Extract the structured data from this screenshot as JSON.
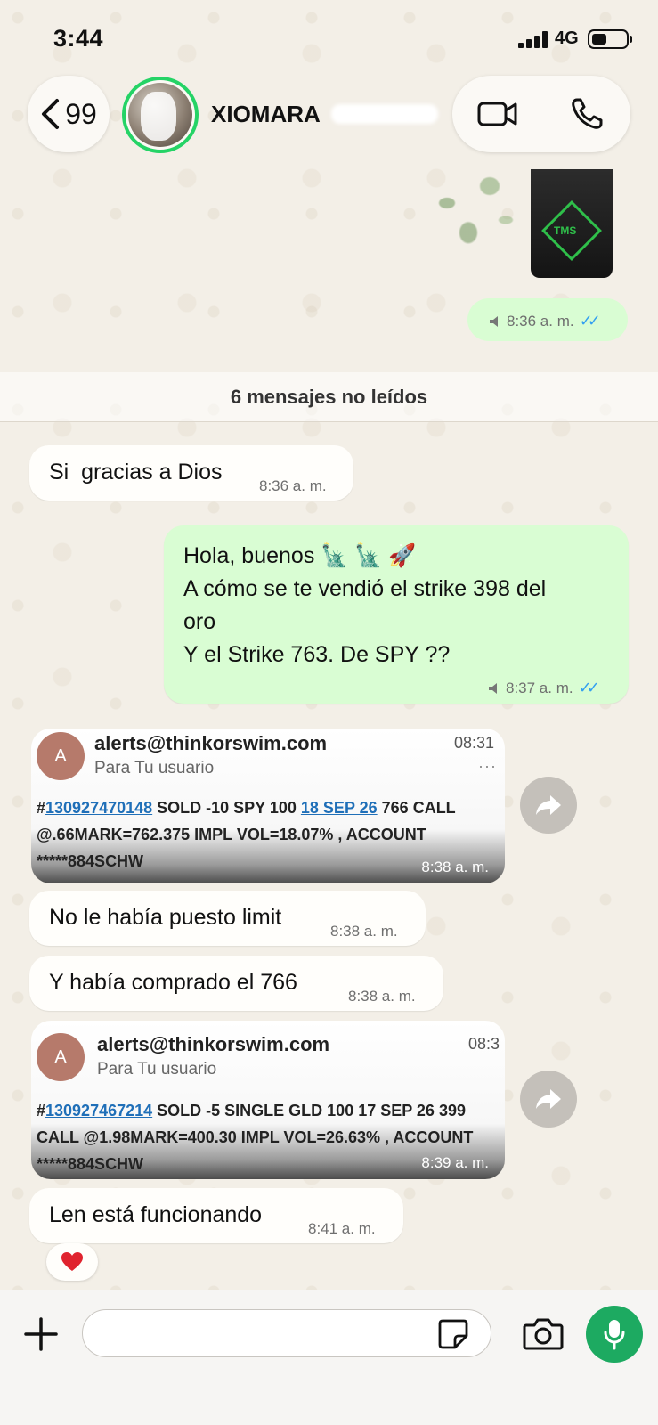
{
  "status_bar": {
    "time": "3:44",
    "network": "4G"
  },
  "header": {
    "back_count": "99",
    "contact_name": "XIOMARA"
  },
  "media_message": {
    "time": "8:36 a. m."
  },
  "unread_divider": "6 mensajes no leídos",
  "messages": [
    {
      "direction": "in",
      "text": "Si  gracias a Dios",
      "time": "8:36 a. m."
    },
    {
      "direction": "out",
      "text": "Hola, buenos 🗽 🗽 🚀\nA cómo se te vendió el strike 398 del\noro\nY el Strike 763. De SPY ??",
      "time": "8:37 a. m."
    },
    {
      "direction": "in",
      "text": "No le había puesto limit",
      "time": "8:38 a. m."
    },
    {
      "direction": "in",
      "text": "Y había comprado el 766",
      "time": "8:38 a. m."
    },
    {
      "direction": "in",
      "text": "Len está funcionando",
      "time": "8:41 a. m."
    }
  ],
  "email_shots": [
    {
      "avatar": "A",
      "from": "alerts@thinkorswim.com",
      "to": "Para Tu usuario",
      "email_time": "08:31",
      "order_id": "130927470148",
      "line1_mid": " SOLD -10 SPY 100 ",
      "expiry": "18 SEP 26",
      "line1_end": " 766 CALL",
      "line2": "@.66MARK=762.375 IMPL VOL=18.07% , ACCOUNT",
      "line3": "*****884SCHW",
      "time": "8:38 a. m."
    },
    {
      "avatar": "A",
      "from": "alerts@thinkorswim.com",
      "to": "Para Tu usuario",
      "email_time": "08:3",
      "order_id": "130927467214",
      "line1_mid": " SOLD -5 SINGLE GLD 100 17 SEP 26 399",
      "line2": "CALL @1.98MARK=400.30 IMPL VOL=26.63% , ACCOUNT",
      "line3": "*****884SCHW",
      "time": "8:39 a. m."
    }
  ],
  "reaction": "heart",
  "composer": {
    "placeholder": ""
  },
  "colors": {
    "accent": "#25d366",
    "outgoing": "#d9fdd3",
    "incoming": "#fffefb",
    "mic": "#1daa61",
    "ticks": "#34a0f0"
  }
}
